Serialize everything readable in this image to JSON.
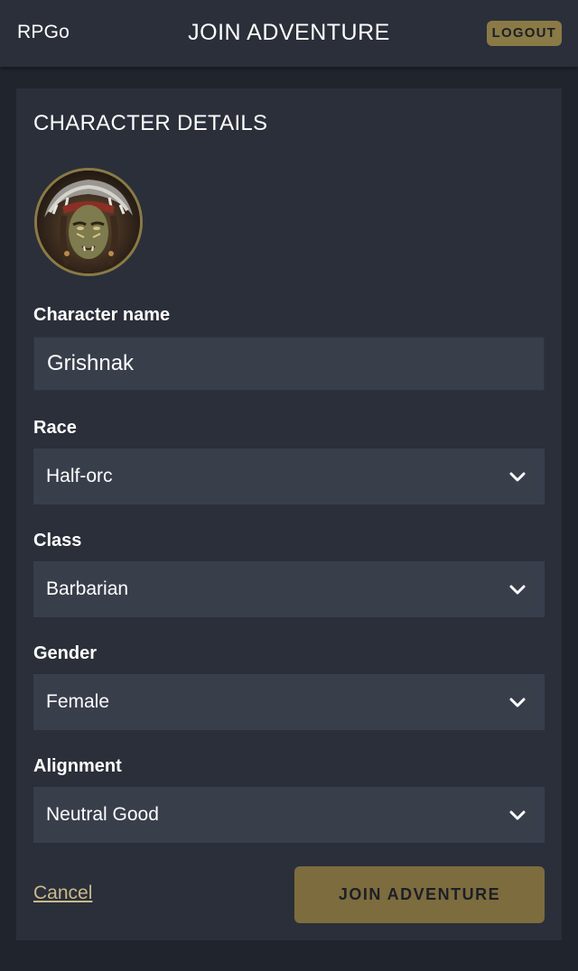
{
  "header": {
    "brand": "RPGo",
    "title": "JOIN ADVENTURE",
    "logout_label": "LOGOUT"
  },
  "card": {
    "title": "CHARACTER DETAILS"
  },
  "avatar": {
    "icon": "character-portrait-half-orc"
  },
  "form": {
    "name": {
      "label": "Character name",
      "value": "Grishnak"
    },
    "race": {
      "label": "Race",
      "value": "Half-orc"
    },
    "class": {
      "label": "Class",
      "value": "Barbarian"
    },
    "gender": {
      "label": "Gender",
      "value": "Female"
    },
    "alignment": {
      "label": "Alignment",
      "value": "Neutral Good"
    }
  },
  "actions": {
    "cancel_label": "Cancel",
    "join_label": "JOIN ADVENTURE"
  },
  "colors": {
    "background": "#20242d",
    "surface": "#2a2f3a",
    "input": "#393e4b",
    "accent_gold": "#7d6c3e",
    "link": "#c9b98a"
  }
}
